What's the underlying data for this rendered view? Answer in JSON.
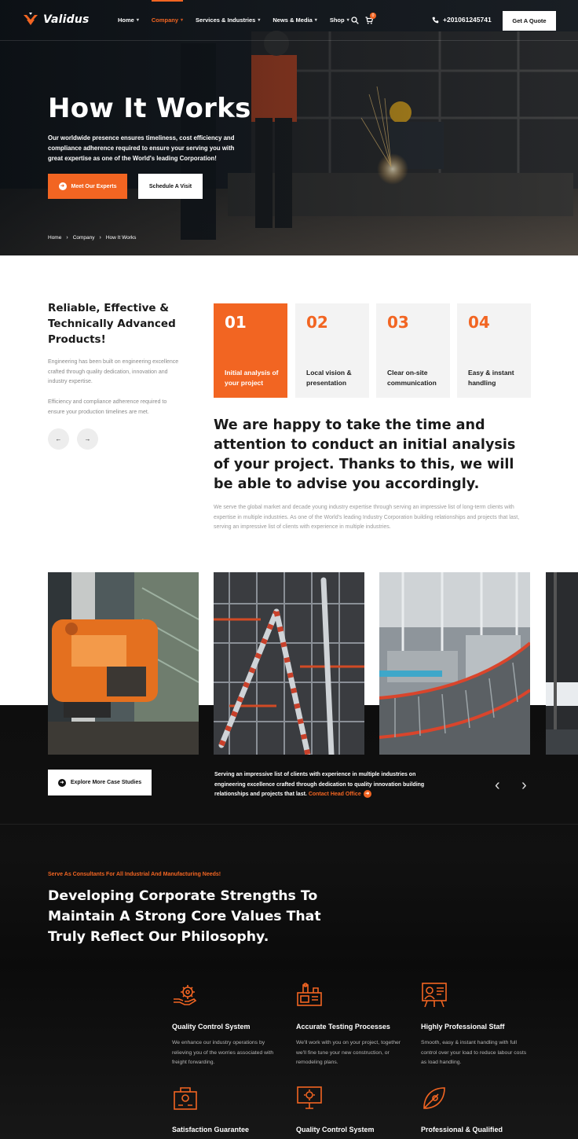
{
  "brand": {
    "name": "Validus",
    "accent": "#f26522"
  },
  "nav": {
    "items": [
      {
        "label": "Home",
        "active": false
      },
      {
        "label": "Company",
        "active": true
      },
      {
        "label": "Services & Industries",
        "active": false
      },
      {
        "label": "News & Media",
        "active": false
      },
      {
        "label": "Shop",
        "active": false
      }
    ],
    "cart_count": "0",
    "phone": "+201061245741",
    "quote_label": "Get A Quote"
  },
  "hero": {
    "title": "How It Works",
    "description": "Our worldwide presence ensures timeliness, cost efficiency and compliance adherence required to ensure your serving you with great expertise as one of the World's leading Corporation!",
    "primary_label": "Meet Our Experts",
    "secondary_label": "Schedule A Visit",
    "breadcrumb": [
      "Home",
      "Company",
      "How It Works"
    ]
  },
  "features": {
    "title": "Reliable, Effective & Technically Advanced Products!",
    "paragraphs": [
      "Engineering has been built on engineering excellence crafted through quality dedication, innovation and industry expertise.",
      "Efficiency and compliance adherence required to ensure your production timelines are met."
    ],
    "steps": [
      {
        "num": "01",
        "label": "Initial analysis of your project",
        "active": true
      },
      {
        "num": "02",
        "label": "Local vision & presentation",
        "active": false
      },
      {
        "num": "03",
        "label": "Clear on-site communication",
        "active": false
      },
      {
        "num": "04",
        "label": "Easy & instant handling",
        "active": false
      }
    ],
    "headline": "We are happy to take the time and attention to conduct an initial analysis of your project. Thanks to this, we will be able to advise you accordingly.",
    "body": "We serve the global market and decade young industry expertise through serving an impressive list of long-term clients with expertise in multiple industries. As one of the World's leading Industry Corporation building relationships and projects that last, serving an impressive list of clients with experience in multiple industries."
  },
  "cases": {
    "explore_label": "Explore More Case Studies",
    "text": "Serving an impressive list of clients with experience in multiple industries on engineering excellence crafted through dedication to quality innovation building relationships and projects that last.",
    "link_label": "Contact Head Office"
  },
  "strengths": {
    "eyebrow": "Serve As Consultants For All Industrial And Manufacturing Needs!",
    "title": "Developing Corporate Strengths To Maintain A Strong Core Values That Truly Reflect Our Philosophy.",
    "services": [
      {
        "icon": "gear-hand-icon",
        "title": "Quality Control System",
        "desc": "We enhance our industry operations by relieving you of the worries associated with freight forwarding."
      },
      {
        "icon": "testing-machine-icon",
        "title": "Accurate Testing Processes",
        "desc": "We'll work with you on your project, together we'll fine tune your new construction, or remodeling plans."
      },
      {
        "icon": "staff-board-icon",
        "title": "Highly Professional Staff",
        "desc": "Smooth, easy & instant handling with full control over your load to reduce labour costs as load handling."
      },
      {
        "icon": "guarantee-icon",
        "title": "Satisfaction Guarantee",
        "desc": ""
      },
      {
        "icon": "monitor-gear-icon",
        "title": "Quality Control System",
        "desc": ""
      },
      {
        "icon": "leaf-gear-icon",
        "title": "Professional & Qualified",
        "desc": ""
      }
    ]
  }
}
